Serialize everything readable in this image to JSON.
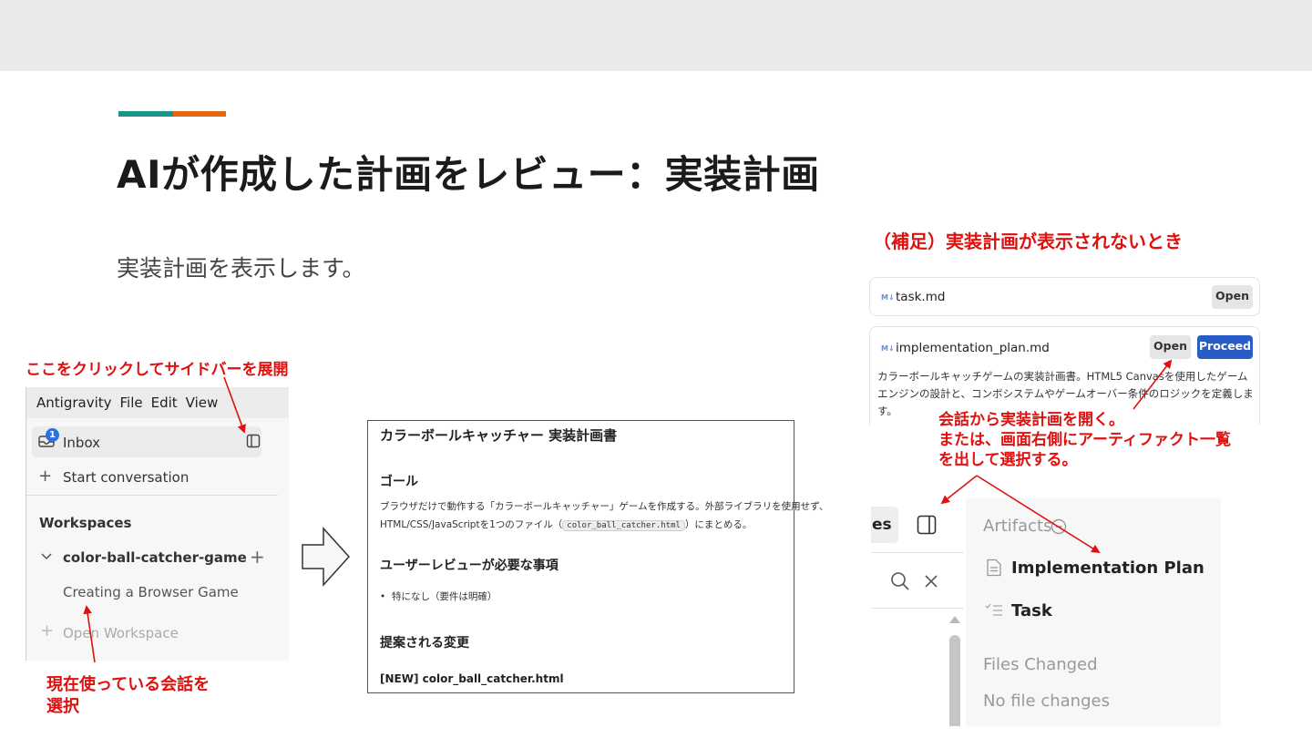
{
  "slide": {
    "title": "AIが作成した計画をレビュー：実装計画",
    "subtitle": "実装計画を表示します。",
    "colors": {
      "accent_teal": "#1a9588",
      "accent_orange": "#e8650f",
      "annotation_red": "#e0100f",
      "proceed_blue": "#2a5cc6"
    }
  },
  "annotations": {
    "sidebar_hint": "ここをクリックしてサイドバーを展開",
    "select_conversation_line1": "現在使っている会話を",
    "select_conversation_line2": "選択",
    "supplement_title": "（補足）実装計画が表示されないとき",
    "open_hint_line1": "会話から実装計画を開く。",
    "open_hint_line2": "または、画面右側にアーティファクト一覧",
    "open_hint_line3": "を出して選択する。"
  },
  "sidebar": {
    "menu": [
      "Antigravity",
      "File",
      "Edit",
      "View"
    ],
    "inbox_label": "Inbox",
    "inbox_badge": "1",
    "start_conversation": "Start conversation",
    "workspaces_heading": "Workspaces",
    "workspace_name": "color-ball-catcher-game",
    "conversation": "Creating a Browser Game",
    "open_workspace": "Open Workspace",
    "icons": {
      "inbox": "inbox-icon",
      "toggle": "sidebar-toggle-icon",
      "plus": "plus-icon",
      "chevron": "chevron-down-icon"
    }
  },
  "document": {
    "title": "カラーボールキャッチャー 実装計画書",
    "goal_heading": "ゴール",
    "goal_line1": "ブラウザだけで動作する「カラーボールキャッチャー」ゲームを作成する。外部ライブラリを使用せず、",
    "goal_line2_pre": "HTML/CSS/JavaScriptを1つのファイル（",
    "goal_line2_code": "color_ball_catcher.html",
    "goal_line2_post": "）にまとめる。",
    "review_heading": "ユーザーレビューが必要な事項",
    "review_item": "特になし（要件は明確）",
    "changes_heading": "提案される変更",
    "new_file": "[NEW] color_ball_catcher.html"
  },
  "artifact_cards": {
    "task": {
      "name": "task.md",
      "open_label": "Open"
    },
    "plan": {
      "name": "implementation_plan.md",
      "open_label": "Open",
      "proceed_label": "Proceed",
      "desc_line1": "カラーボールキャッチゲームの実装計画書。HTML5 Canvasを使用したゲーム",
      "desc_line2": "エンジンの設計と、コンボシステムやゲームオーバー条件のロジックを定義しま",
      "desc_line3": "す。"
    },
    "md_badge": "M↓"
  },
  "right_panel": {
    "tab_fragment": "es",
    "artifacts_heading": "Artifacts",
    "implementation_plan": "Implementation Plan",
    "task": "Task",
    "files_changed_heading": "Files Changed",
    "no_file_changes": "No file changes",
    "icons": {
      "toggle": "panel-toggle-icon",
      "search": "search-icon",
      "close": "close-icon",
      "info": "info-icon",
      "document": "document-icon",
      "checklist": "checklist-icon",
      "scroll_up": "scroll-up-icon"
    }
  }
}
